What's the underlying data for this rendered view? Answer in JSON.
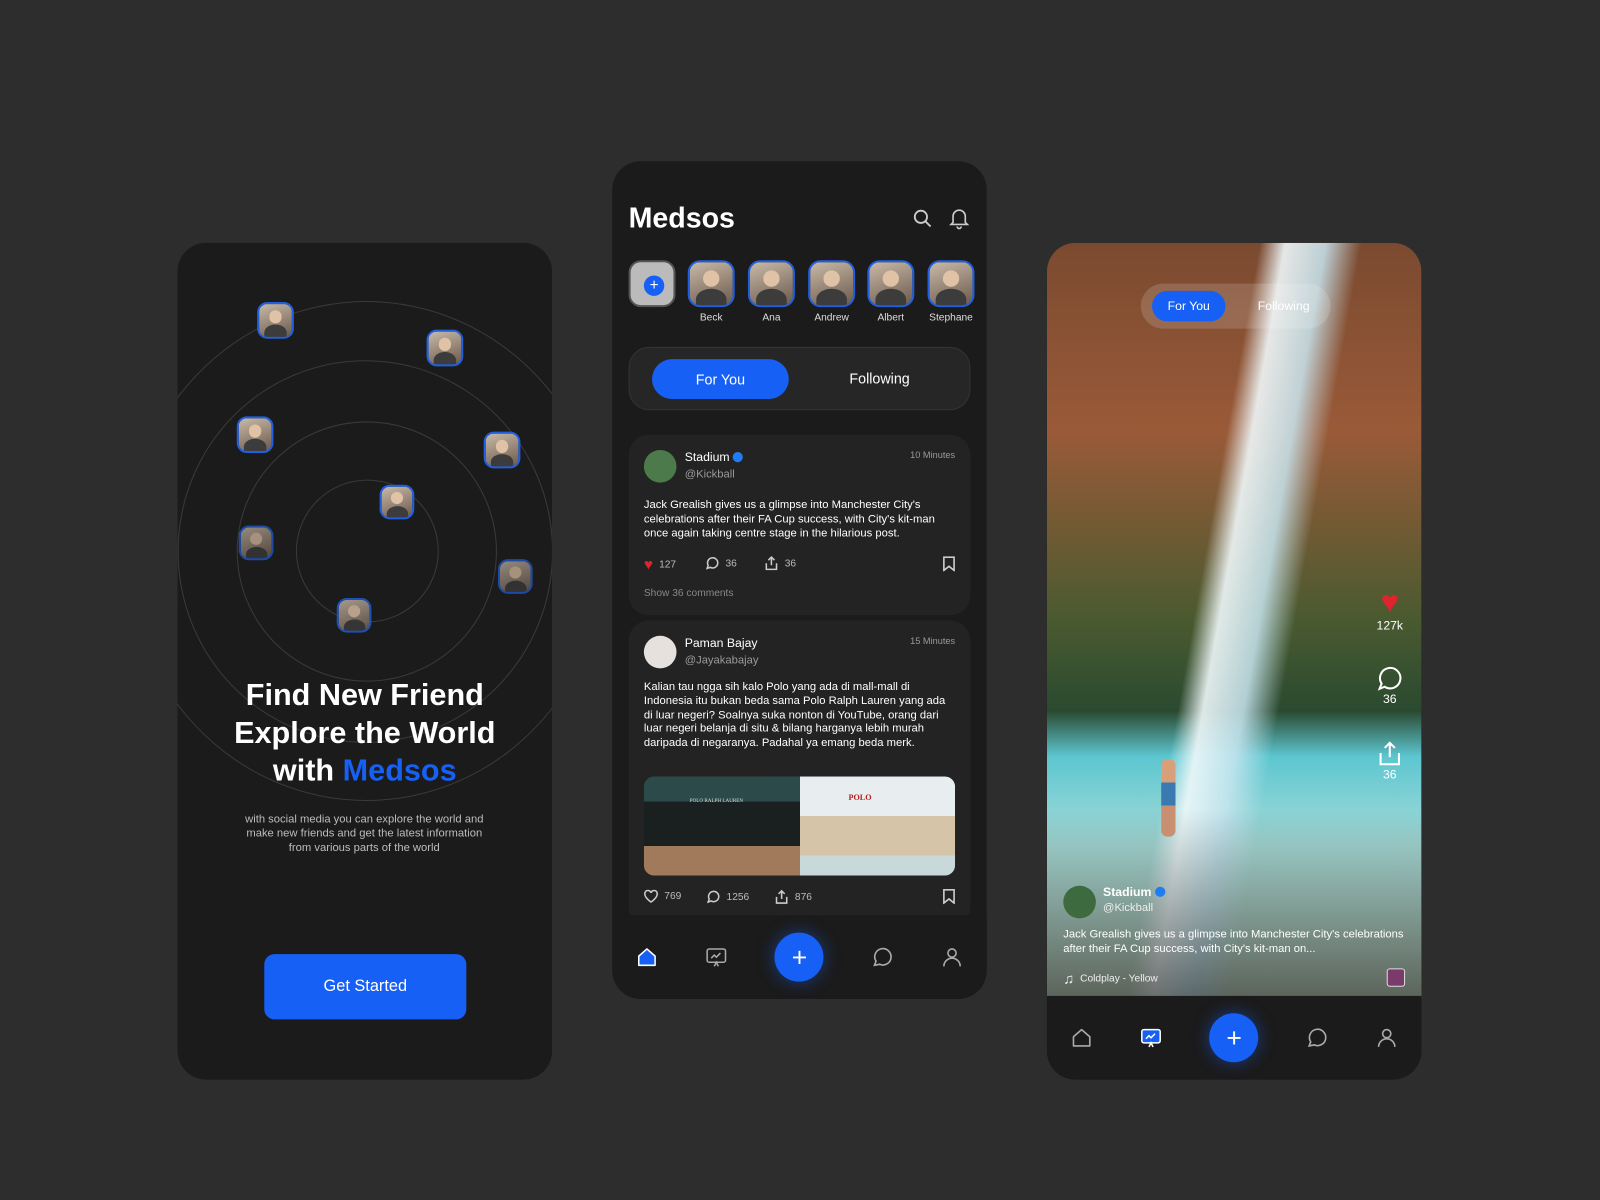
{
  "onboarding": {
    "title_line1": "Find New Friend",
    "title_line2": "Explore the World",
    "title_with": "with",
    "brand": "Medsos",
    "description": "with social media you can explore the world and make new friends and get the latest information from various parts of the world",
    "cta": "Get Started"
  },
  "feed": {
    "app_title": "Medsos",
    "stories": [
      {
        "name": "Beck"
      },
      {
        "name": "Ana"
      },
      {
        "name": "Andrew"
      },
      {
        "name": "Albert"
      },
      {
        "name": "Stephane"
      }
    ],
    "tabs": {
      "for_you": "For You",
      "following": "Following"
    },
    "posts": [
      {
        "name": "Stadium",
        "handle": "@Kickball",
        "time": "10 Minutes",
        "verified": true,
        "text": "Jack Grealish gives us a glimpse into Manchester City's celebrations after their FA Cup success, with City's kit-man once again taking centre stage in the hilarious post.",
        "likes": "127",
        "comments": "36",
        "shares": "36",
        "show_comments": "Show 36 comments",
        "liked": true
      },
      {
        "name": "Paman Bajay",
        "handle": "@Jayakabajay",
        "time": "15 Minutes",
        "text": "Kalian tau ngga sih kalo Polo yang ada di mall-mall di Indonesia itu bukan beda sama Polo Ralph Lauren yang ada di luar negeri? Soalnya suka nonton di YouTube, orang dari luar negeri belanja di situ & bilang harganya lebih murah daripada di negaranya. Padahal ya emang beda merk.",
        "likes": "769",
        "comments": "1256",
        "shares": "876",
        "image_sign1": "POLO RALPH LAUREN",
        "image_sign2": "POLO"
      }
    ]
  },
  "video": {
    "tabs": {
      "for_you": "For You",
      "following": "Following"
    },
    "likes": "127k",
    "comments": "36",
    "shares": "36",
    "name": "Stadium",
    "handle": "@Kickball",
    "caption": "Jack Grealish gives us a glimpse into Manchester City's celebrations after their FA Cup success, with City's kit-man on...",
    "music": "Coldplay - Yellow"
  },
  "colors": {
    "accent": "#1760f5",
    "background": "#2d2d2d",
    "card": "#232323",
    "like": "#e0232e"
  }
}
